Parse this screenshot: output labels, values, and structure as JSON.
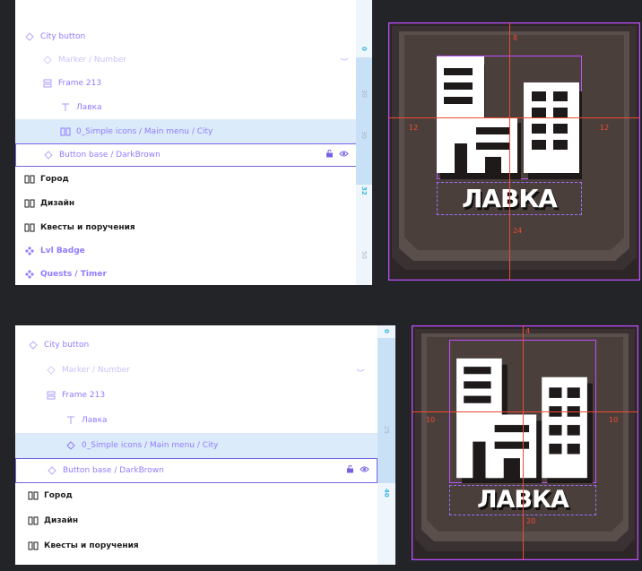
{
  "panels": [
    {
      "id": "top",
      "layers": [
        {
          "label": "City button",
          "icon": "diamond-outline-icon",
          "style": "violet",
          "indent": 0
        },
        {
          "label": "Marker / Number",
          "icon": "diamond-outline-icon",
          "style": "violet-faint",
          "indent": 1
        },
        {
          "label": "Frame 213",
          "icon": "frame-stack-icon",
          "style": "violet",
          "indent": 1
        },
        {
          "label": "Лавка",
          "icon": "text-icon",
          "style": "violet",
          "indent": 2
        },
        {
          "label": "0_Simple icons / Main menu / City",
          "icon": "component-instance-icon",
          "style": "violet",
          "indent": 2
        },
        {
          "label": "Button base / DarkBrown",
          "icon": "diamond-outline-icon",
          "style": "violet",
          "indent": 1
        },
        {
          "label": "Город",
          "icon": "section-icon",
          "style": "dark",
          "indent": 0
        },
        {
          "label": "Дизайн",
          "icon": "section-icon",
          "style": "dark",
          "indent": 0
        },
        {
          "label": "Квесты и поручения",
          "icon": "section-icon",
          "style": "dark",
          "indent": 0
        },
        {
          "label": "Lvl Badge",
          "icon": "component-set-icon",
          "style": "violet-bold",
          "indent": 0
        },
        {
          "label": "Quests / Timer",
          "icon": "component-set-icon",
          "style": "violet-bold",
          "indent": 0
        }
      ],
      "ruler": [
        "0",
        "30",
        "30",
        "32",
        "50"
      ],
      "preview": {
        "label": "ЛАВКА",
        "dims": {
          "top": "8",
          "left": "12",
          "right": "12",
          "bottom": "24"
        }
      }
    },
    {
      "id": "bottom",
      "layers": [
        {
          "label": "City button",
          "icon": "diamond-outline-icon",
          "style": "violet",
          "indent": 0
        },
        {
          "label": "Marker / Number",
          "icon": "diamond-outline-icon",
          "style": "violet-faint",
          "indent": 1
        },
        {
          "label": "Frame 213",
          "icon": "frame-stack-icon",
          "style": "violet",
          "indent": 1
        },
        {
          "label": "Лавка",
          "icon": "text-icon",
          "style": "violet",
          "indent": 2
        },
        {
          "label": "0_Simple icons / Main menu / City",
          "icon": "diamond-outline-icon",
          "style": "violet",
          "indent": 2
        },
        {
          "label": "Button base / DarkBrown",
          "icon": "diamond-outline-icon",
          "style": "violet",
          "indent": 1
        },
        {
          "label": "Город",
          "icon": "section-icon",
          "style": "dark",
          "indent": 0
        },
        {
          "label": "Дизайн",
          "icon": "section-icon",
          "style": "dark",
          "indent": 0
        },
        {
          "label": "Квесты и поручения",
          "icon": "section-icon",
          "style": "dark",
          "indent": 0
        }
      ],
      "ruler": [
        "0",
        "25",
        "40"
      ],
      "preview": {
        "label": "ЛАВКА",
        "dims": {
          "top": "4",
          "left": "10",
          "right": "10",
          "bottom": "20"
        }
      }
    }
  ],
  "colors": {
    "violet": "#8f7cff",
    "selection": "#dcebfa",
    "frame_outline": "#c050ff",
    "spacing": "#f04a33",
    "button_base": "#4a3f3b"
  }
}
